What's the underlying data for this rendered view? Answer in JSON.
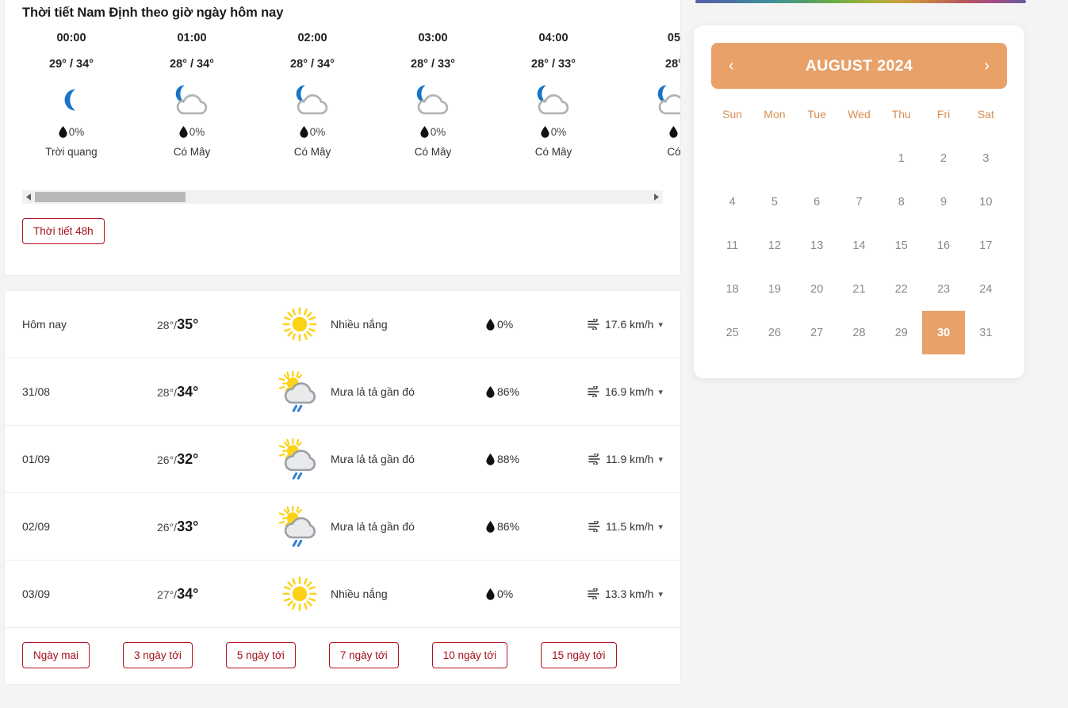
{
  "hourly": {
    "title": "Thời tiết Nam Định theo giờ ngày hôm nay",
    "button_48h": "Thời tiết 48h",
    "columns": [
      {
        "time": "00:00",
        "temp": "29° / 34°",
        "icon": "moon-icon",
        "pop": "0%",
        "desc": "Trời quang"
      },
      {
        "time": "01:00",
        "temp": "28° / 34°",
        "icon": "moon-cloud-icon",
        "pop": "0%",
        "desc": "Có Mây"
      },
      {
        "time": "02:00",
        "temp": "28° / 34°",
        "icon": "moon-cloud-icon",
        "pop": "0%",
        "desc": "Có Mây"
      },
      {
        "time": "03:00",
        "temp": "28° / 33°",
        "icon": "moon-cloud-icon",
        "pop": "0%",
        "desc": "Có Mây"
      },
      {
        "time": "04:00",
        "temp": "28° / 33°",
        "icon": "moon-cloud-icon",
        "pop": "0%",
        "desc": "Có Mây"
      },
      {
        "time": "05",
        "temp": "28°",
        "icon": "moon-cloud-icon",
        "pop": "",
        "desc": "Có"
      }
    ],
    "scroll": {
      "left_arrow": "◀",
      "right_arrow": "▶",
      "thumb_percent": 24.5
    }
  },
  "daily": {
    "rows": [
      {
        "date": "Hôm nay",
        "lo": "28°/",
        "hi": "35°",
        "icon": "sun-icon",
        "desc": "Nhiều nắng",
        "pop": "0%",
        "wind": "17.6 km/h"
      },
      {
        "date": "31/08",
        "lo": "28°/",
        "hi": "34°",
        "icon": "sun-cloud-rain-icon",
        "desc": "Mưa lả tả gần đó",
        "pop": "86%",
        "wind": "16.9 km/h"
      },
      {
        "date": "01/09",
        "lo": "26°/",
        "hi": "32°",
        "icon": "sun-cloud-rain-icon",
        "desc": "Mưa lả tả gần đó",
        "pop": "88%",
        "wind": "11.9 km/h"
      },
      {
        "date": "02/09",
        "lo": "26°/",
        "hi": "33°",
        "icon": "sun-cloud-rain-icon",
        "desc": "Mưa lả tả gần đó",
        "pop": "86%",
        "wind": "11.5 km/h"
      },
      {
        "date": "03/09",
        "lo": "27°/",
        "hi": "34°",
        "icon": "sun-icon",
        "desc": "Nhiều nắng",
        "pop": "0%",
        "wind": "13.3 km/h"
      }
    ],
    "range_buttons": [
      "Ngày mai",
      "3 ngày tới",
      "5 ngày tới",
      "7 ngày tới",
      "10 ngày tới",
      "15 ngày tới"
    ]
  },
  "calendar": {
    "title": "AUGUST 2024",
    "prev_icon": "chevron-left-icon",
    "next_icon": "chevron-right-icon",
    "prev_label": "‹",
    "next_label": "›",
    "dow": [
      "Sun",
      "Mon",
      "Tue",
      "Wed",
      "Thu",
      "Fri",
      "Sat"
    ],
    "leading_blanks": 4,
    "days": [
      1,
      2,
      3,
      4,
      5,
      6,
      7,
      8,
      9,
      10,
      11,
      12,
      13,
      14,
      15,
      16,
      17,
      18,
      19,
      20,
      21,
      22,
      23,
      24,
      25,
      26,
      27,
      28,
      29,
      30,
      31
    ],
    "today": 30,
    "accent_color": "#e8a169",
    "dow_color": "#d98f53"
  },
  "colors": {
    "page_bg": "#f4f4f4",
    "card_bg": "#ffffff",
    "outline_button_border": "#b5121b",
    "outline_button_text": "#a31119",
    "moon_blue": "#1a73c8",
    "cloud_gray": "#b0b4b8",
    "sun_yellow": "#fcd217",
    "rain_blue": "#2f7fd1"
  }
}
